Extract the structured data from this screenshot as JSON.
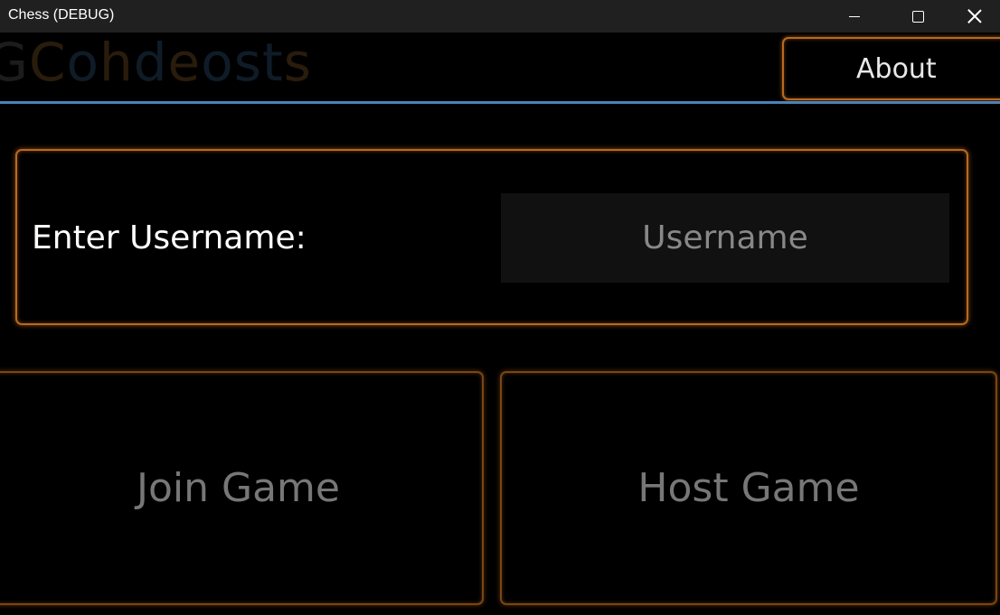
{
  "window": {
    "title": "Chess (DEBUG)"
  },
  "header": {
    "logo_letters": [
      {
        "char": "G",
        "color": "#1c1c1c"
      },
      {
        "char": "C",
        "color": "#2a1c0c"
      },
      {
        "char": "o",
        "color": "#0f1c28"
      },
      {
        "char": "h",
        "color": "#2a1c0c"
      },
      {
        "char": "d",
        "color": "#0f1c28"
      },
      {
        "char": "e",
        "color": "#2a1c0c"
      },
      {
        "char": "o",
        "color": "#0f1c28"
      },
      {
        "char": "s",
        "color": "#0f1c28"
      },
      {
        "char": "t",
        "color": "#0f1c28"
      },
      {
        "char": "s",
        "color": "#2a1c0c"
      }
    ],
    "about_label": "About"
  },
  "username": {
    "label": "Enter Username:",
    "value": "",
    "placeholder": "Username"
  },
  "actions": {
    "join_label": "Join Game",
    "host_label": "Host Game"
  },
  "colors": {
    "accent_orange": "#b86a20",
    "divider_blue": "#4a82b8",
    "background": "#000000"
  }
}
